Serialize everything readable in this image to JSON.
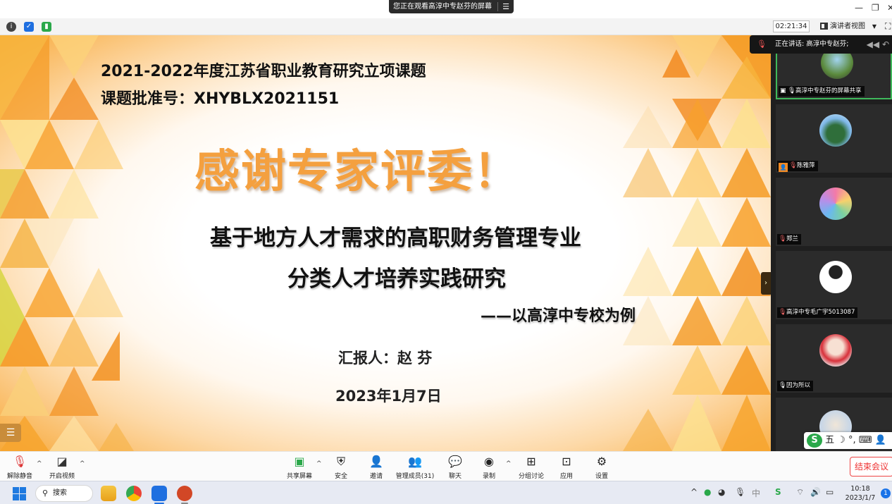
{
  "sharing_banner": {
    "text": "您正在观看高淳中专赵芬的屏幕"
  },
  "toolbar_top": {
    "timer": "02:21:34",
    "view_label": "演讲者视图"
  },
  "slide": {
    "line1": "2021-2022年度江苏省职业教育研究立项课题",
    "line2": "课题批准号：XHYBLX2021151",
    "headline": "感谢专家评委！",
    "subtitle1": "基于地方人才需求的高职财务管理专业",
    "subtitle2": "分类人才培养实践研究",
    "subtitle3": "——以高淳中专校为例",
    "reporter": "汇报人：赵 芬",
    "date": "2023年1月7日"
  },
  "side_panel": {
    "speaking_label": "正在讲话: 高淳中专赵芬;",
    "participants": [
      {
        "name": "高淳中专赵芬的屏幕共享",
        "icon": "screen-share-icon"
      },
      {
        "name": "陈雅萍",
        "icon": "mic-muted-icon"
      },
      {
        "name": "郑兰",
        "icon": "mic-muted-icon"
      },
      {
        "name": "高淳中专毛广宇5013087",
        "icon": "mic-muted-icon"
      },
      {
        "name": "因为所以",
        "icon": "mic-icon"
      }
    ]
  },
  "ime": {
    "text": "五 ☽ °, ⌨ 👤"
  },
  "meeting_toolbar": {
    "unmute": "解除静音",
    "start_video": "开启视频",
    "share_screen": "共享屏幕",
    "security": "安全",
    "invite": "邀请",
    "participants": "管理成员(31)",
    "chat": "聊天",
    "record": "录制",
    "breakout": "分组讨论",
    "apps": "应用",
    "settings": "设置",
    "end_meeting": "结束会议"
  },
  "taskbar": {
    "search_label": "搜索",
    "time": "10:18",
    "date": "2023/1/7",
    "notifications": "1"
  },
  "colors": {
    "accent_orange": "#f4a03f",
    "end_red": "#e33333",
    "active_green": "#3fb95b"
  }
}
